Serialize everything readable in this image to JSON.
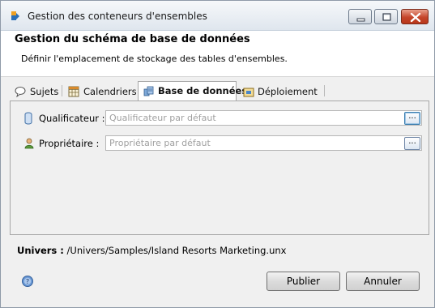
{
  "window": {
    "title": "Gestion des conteneurs d'ensembles"
  },
  "header": {
    "title": "Gestion du schéma de base de données",
    "description": "Définir l'emplacement de stockage des tables d'ensembles."
  },
  "tabs": [
    {
      "label": "Sujets",
      "icon": "speech-bubble-icon",
      "active": false
    },
    {
      "label": "Calendriers",
      "icon": "calendar-icon",
      "active": false
    },
    {
      "label": "Base de données",
      "icon": "database-icon",
      "active": true
    },
    {
      "label": "Déploiement",
      "icon": "deployment-icon",
      "active": false
    }
  ],
  "fields": {
    "qualifier": {
      "label": "Qualificateur :",
      "placeholder": "Qualificateur par défaut",
      "value": "",
      "browse_label": "..."
    },
    "owner": {
      "label": "Propriétaire :",
      "placeholder": "Propriétaire par défaut",
      "value": "",
      "browse_label": "..."
    }
  },
  "universe": {
    "label": "Univers :",
    "path": "/Univers/Samples/Island Resorts Marketing.unx"
  },
  "buttons": {
    "publish": "Publier",
    "cancel": "Annuler"
  }
}
